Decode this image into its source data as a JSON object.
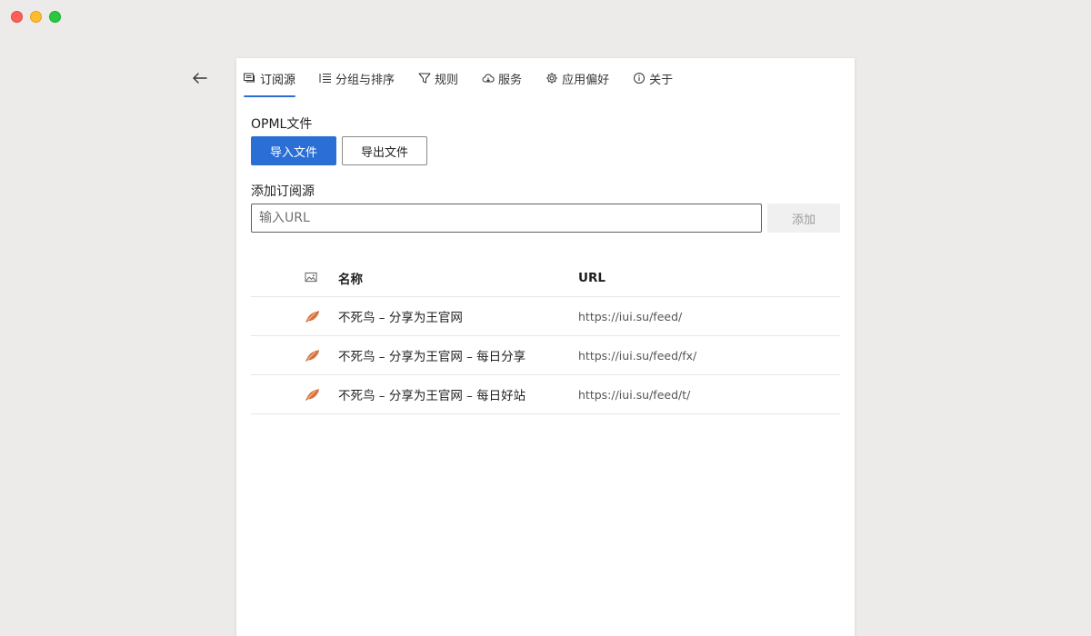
{
  "window": {
    "traffic_lights": [
      "close",
      "minimize",
      "maximize"
    ]
  },
  "nav": {
    "back_icon": "arrow-left-icon"
  },
  "tabs": [
    {
      "label": "订阅源",
      "icon": "feeds-icon",
      "active": true
    },
    {
      "label": "分组与排序",
      "icon": "list-icon",
      "active": false
    },
    {
      "label": "规则",
      "icon": "filter-icon",
      "active": false
    },
    {
      "label": "服务",
      "icon": "cloud-icon",
      "active": false
    },
    {
      "label": "应用偏好",
      "icon": "gear-icon",
      "active": false
    },
    {
      "label": "关于",
      "icon": "info-icon",
      "active": false
    }
  ],
  "opml": {
    "label": "OPML文件",
    "import_label": "导入文件",
    "export_label": "导出文件"
  },
  "add_feed": {
    "label": "添加订阅源",
    "placeholder": "输入URL",
    "value": "",
    "button_label": "添加"
  },
  "table": {
    "header_icon": "image-icon",
    "header_name": "名称",
    "header_url": "URL",
    "rows": [
      {
        "name": "不死鸟 – 分享为王官网",
        "url": "https://iui.su/feed/",
        "icon": "phoenix-feather-icon"
      },
      {
        "name": "不死鸟 – 分享为王官网 – 每日分享",
        "url": "https://iui.su/feed/fx/",
        "icon": "phoenix-feather-icon"
      },
      {
        "name": "不死鸟 – 分享为王官网 – 每日好站",
        "url": "https://iui.su/feed/t/",
        "icon": "phoenix-feather-icon"
      }
    ]
  },
  "colors": {
    "accent": "#2b6fd6",
    "background": "#ecebea",
    "panel": "#ffffff"
  }
}
